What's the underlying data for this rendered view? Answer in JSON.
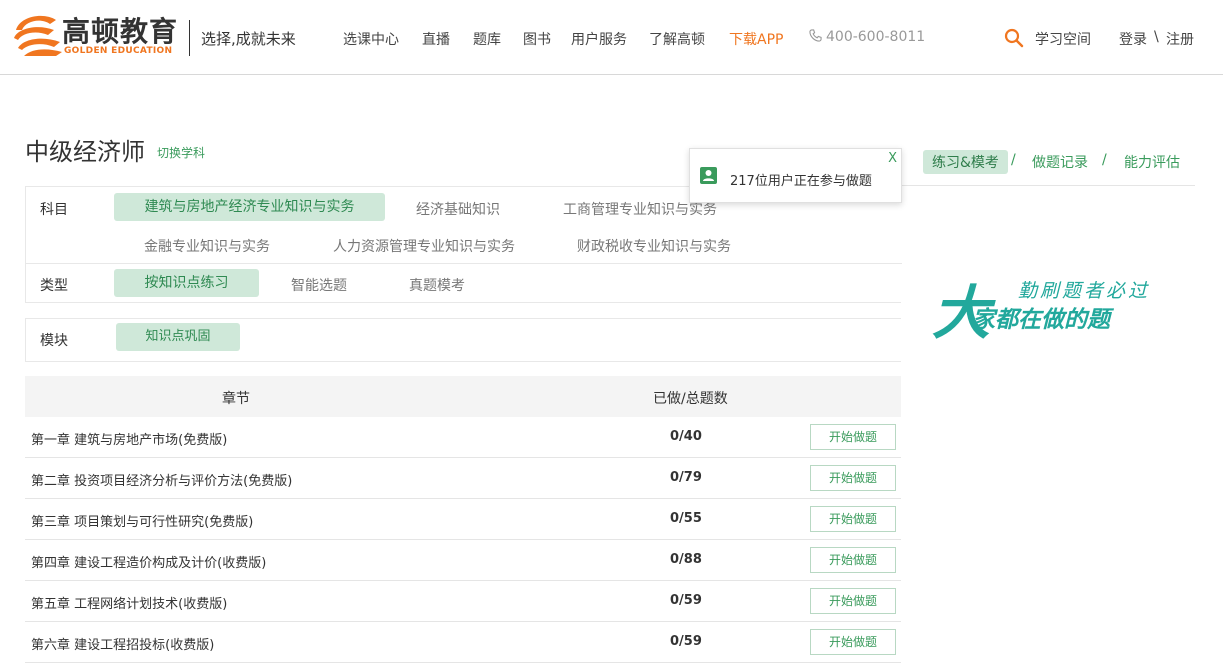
{
  "header": {
    "logo_cn": "高顿教育",
    "logo_en": "GOLDEN EDUCATION",
    "slogan": "选择,成就未来",
    "nav": [
      "选课中心",
      "直播",
      "题库",
      "图书",
      "用户服务",
      "了解高顿"
    ],
    "download": "下载APP",
    "phone": "400-600-8011",
    "study_space": "学习空间",
    "login": "登录",
    "separator": "\\",
    "register": "注册"
  },
  "page": {
    "title": "中级经济师",
    "switch_subject": "切换学科"
  },
  "right_tabs": {
    "practice": "练习&模考",
    "records": "做题记录",
    "ability": "能力评估",
    "sep": "/"
  },
  "popup": {
    "close": "X",
    "message": "217位用户正在参与做题"
  },
  "filters": {
    "subject_label": "科目",
    "subjects": [
      "建筑与房地产经济专业知识与实务",
      "经济基础知识",
      "工商管理专业知识与实务",
      "金融专业知识与实务",
      "人力资源管理专业知识与实务",
      "财政税收专业知识与实务"
    ],
    "type_label": "类型",
    "types": [
      "按知识点练习",
      "智能选题",
      "真题模考"
    ],
    "module_label": "模块",
    "modules": [
      "知识点巩固"
    ]
  },
  "table": {
    "col_chapter": "章节",
    "col_count": "已做/总题数",
    "start_label": "开始做题",
    "rows": [
      {
        "name": "第一章  建筑与房地产市场(免费版)",
        "count": "0/40"
      },
      {
        "name": "第二章  投资项目经济分析与评价方法(免费版)",
        "count": "0/79"
      },
      {
        "name": "第三章  项目策划与可行性研究(免费版)",
        "count": "0/55"
      },
      {
        "name": "第四章  建设工程造价构成及计价(收费版)",
        "count": "0/88"
      },
      {
        "name": "第五章  工程网络计划技术(收费版)",
        "count": "0/59"
      },
      {
        "name": "第六章  建设工程招投标(收费版)",
        "count": "0/59"
      }
    ]
  },
  "promo": {
    "line1": "勤刷题者必过",
    "line2_big": "大",
    "line2_rest": "家都在做的题"
  },
  "colors": {
    "brand_orange": "#f07620",
    "green": "#3a9b5c",
    "green_bg": "#cfe8d9",
    "promo_teal": "#22a89c"
  }
}
